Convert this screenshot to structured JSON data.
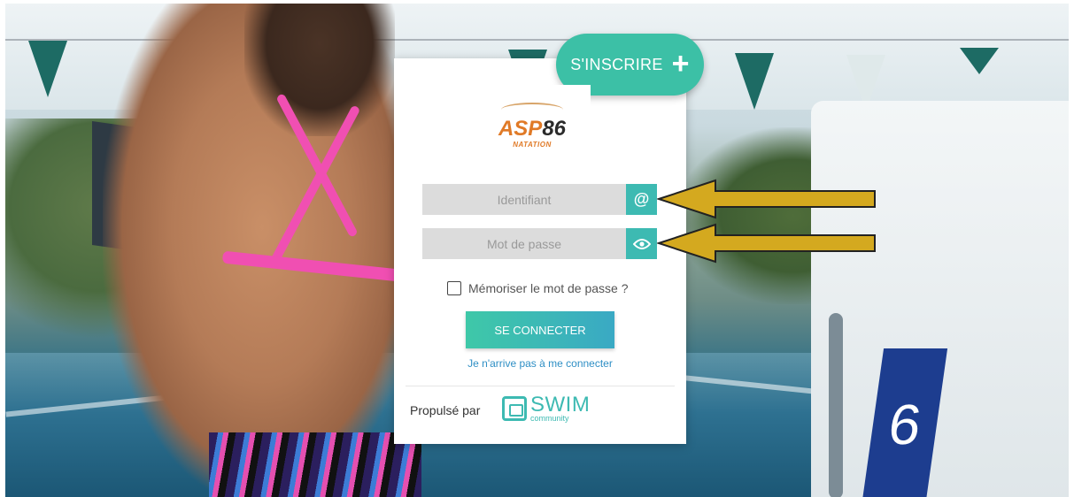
{
  "colors": {
    "accent": "#3dbab2",
    "signup": "#3cc0a6",
    "link": "#2f8fc5",
    "arrow": "#d4a91f"
  },
  "signup": {
    "label": "S'INSCRIRE",
    "icon": "plus-icon"
  },
  "logo": {
    "brand_left": "ASP",
    "brand_right": "86",
    "subtitle": "NATATION"
  },
  "login": {
    "username_placeholder": "Identifiant",
    "username_icon": "at-icon",
    "username_symbol": "@",
    "password_placeholder": "Mot de passe",
    "password_icon": "eye-icon",
    "remember_label": "Mémoriser le mot de passe ?",
    "submit_label": "SE CONNECTER",
    "forgot_label": "Je n'arrive pas à me connecter"
  },
  "footer": {
    "powered_label": "Propulsé par",
    "partner_name": "SWIM",
    "partner_sub": "community"
  },
  "background": {
    "lane_number": "6"
  }
}
